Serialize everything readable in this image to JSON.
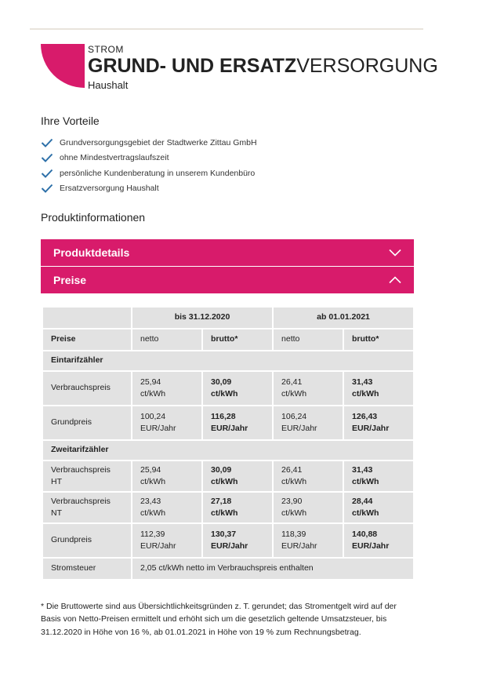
{
  "header": {
    "kicker": "STROM",
    "title_bold": "GRUND- UND ERSATZ",
    "title_light": "VERSORGUNG",
    "subtitle": "Haushalt",
    "brand_color": "#d81b6b"
  },
  "benefits": {
    "heading": "Ihre Vorteile",
    "items": [
      "Grundversorgungsgebiet der Stadtwerke Zittau GmbH",
      "ohne Mindestvertragslaufszeit",
      "persönliche Kundenberatung in unserem Kundenbüro",
      "Ersatzversorgung Haushalt"
    ]
  },
  "product_info": {
    "heading": "Produktinformationen",
    "accordion": [
      {
        "label": "Produktdetails",
        "state": "collapsed",
        "icon": "chevron-down-icon"
      },
      {
        "label": "Preise",
        "state": "expanded",
        "icon": "chevron-up-icon"
      }
    ]
  },
  "prices": {
    "period_1": "bis 31.12.2020",
    "period_2": "ab 01.01.2021",
    "col_label": "Preise",
    "netto": "netto",
    "brutto": "brutto*",
    "group_1": "Eintarifzähler",
    "group_2": "Zweitarifzähler",
    "rows": [
      {
        "label": "Verbrauchspreis",
        "v1": "25,94\nct/kWh",
        "v2": "30,09\nct/kWh",
        "v3": "26,41\nct/kWh",
        "v4": "31,43\nct/kWh"
      },
      {
        "label": "Grundpreis",
        "v1": "100,24\nEUR/Jahr",
        "v2": "116,28\nEUR/Jahr",
        "v3": "106,24\nEUR/Jahr",
        "v4": "126,43\nEUR/Jahr"
      },
      {
        "label": "Verbrauchspreis\nHT",
        "v1": "25,94\nct/kWh",
        "v2": "30,09\nct/kWh",
        "v3": "26,41\nct/kWh",
        "v4": "31,43\nct/kWh"
      },
      {
        "label": "Verbrauchspreis\nNT",
        "v1": "23,43\nct/kWh",
        "v2": "27,18\nct/kWh",
        "v3": "23,90\nct/kWh",
        "v4": "28,44\nct/kWh"
      },
      {
        "label": "Grundpreis",
        "v1": "112,39\nEUR/Jahr",
        "v2": "130,37\nEUR/Jahr",
        "v3": "118,39\nEUR/Jahr",
        "v4": "140,88\nEUR/Jahr"
      }
    ],
    "tax_label": "Stromsteuer",
    "tax_value": "2,05 ct/kWh netto im Verbrauchspreis enthalten"
  },
  "footnote": "* Die Bruttowerte sind aus Übersichtlichkeitsgründen z. T. gerundet; das Stromentgelt wird auf der Basis von Netto-Preisen ermittelt und erhöht sich um die gesetzlich geltende Umsatzsteuer, bis 31.12.2020 in Höhe von 16 %, ab 01.01.2021 in Höhe von 19 % zum Rechnungsbetrag."
}
